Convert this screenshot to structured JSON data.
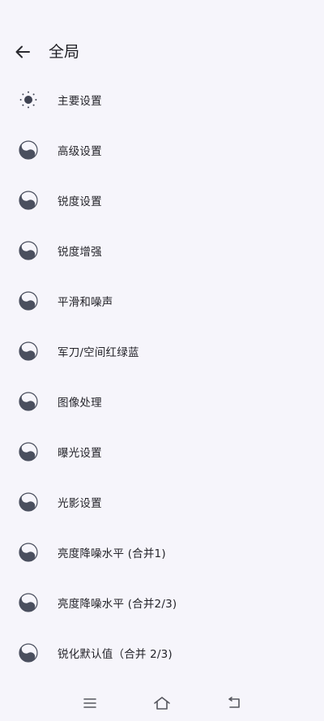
{
  "header": {
    "title": "全局"
  },
  "items": [
    {
      "label": "主要设置",
      "icon": "sun-icon"
    },
    {
      "label": "高级设置",
      "icon": "yin-yang-icon"
    },
    {
      "label": "锐度设置",
      "icon": "yin-yang-icon"
    },
    {
      "label": "锐度增强",
      "icon": "yin-yang-icon"
    },
    {
      "label": "平滑和噪声",
      "icon": "yin-yang-icon"
    },
    {
      "label": "军刀/空间红绿蓝",
      "icon": "yin-yang-icon"
    },
    {
      "label": "图像处理",
      "icon": "yin-yang-icon"
    },
    {
      "label": "曝光设置",
      "icon": "yin-yang-icon"
    },
    {
      "label": "光影设置",
      "icon": "yin-yang-icon"
    },
    {
      "label": "亮度降噪水平 (合并1)",
      "icon": "yin-yang-icon"
    },
    {
      "label": "亮度降噪水平 (合并2/3)",
      "icon": "yin-yang-icon"
    },
    {
      "label": "锐化默认值（合并 2/3)",
      "icon": "yin-yang-icon"
    }
  ],
  "colors": {
    "background": "#f6f5fb",
    "icon": "#4a4f5e",
    "text": "#24242a"
  }
}
